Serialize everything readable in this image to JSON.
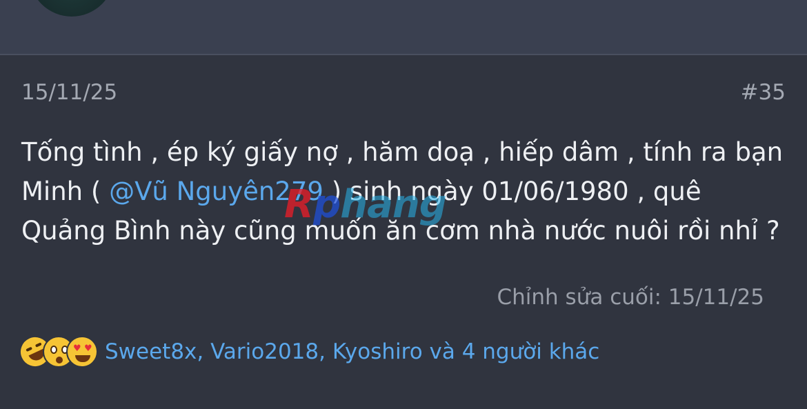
{
  "post": {
    "date": "15/11/25",
    "number": "#35",
    "body_before_mention": "Tống tình , ép ký giấy nợ , hăm doạ , hiếp dâm , tính ra bạn Minh ( ",
    "mention": "@Vũ Nguyên279",
    "body_after_mention": " ) sinh ngày 01/06/1980 , quê Quảng Bình này cũng muốn ăn cơm nhà nước nuôi rồi nhỉ ?",
    "last_edited": "Chỉnh sửa cuối: 15/11/25"
  },
  "reactions": {
    "icons": [
      "rolling-laugh-icon",
      "astonished-icon",
      "heart-eyes-icon"
    ],
    "summary": "Sweet8x, Vario2018, Kyoshiro và 4 người khác"
  },
  "watermark": {
    "letter_r": "R",
    "letter_p": "p",
    "rest": "hang"
  }
}
